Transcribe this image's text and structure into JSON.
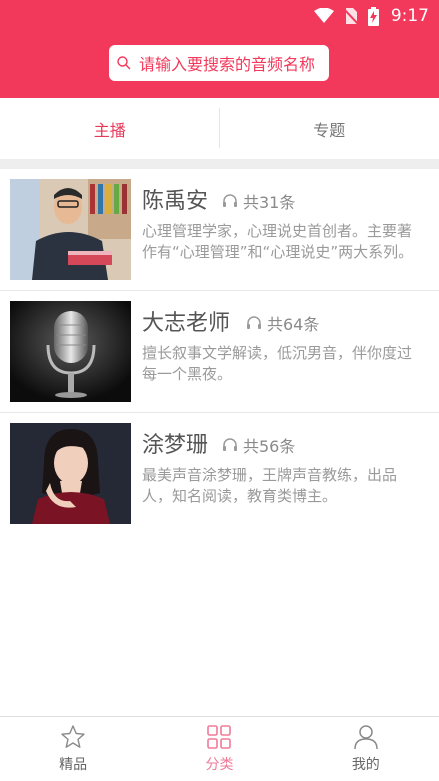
{
  "status": {
    "time": "9:17"
  },
  "search": {
    "placeholder": "请输入要搜索的音频名称"
  },
  "tabs": [
    {
      "label": "主播",
      "active": true
    },
    {
      "label": "专题",
      "active": false
    }
  ],
  "anchors": [
    {
      "name": "陈禹安",
      "count": "共31条",
      "desc": "心理管理学家，心理说史首创者。主要著作有“心理管理”和“心理说史”两大系列。",
      "photo": "photo-man-holding-book"
    },
    {
      "name": "大志老师",
      "count": "共64条",
      "desc": "擅长叙事文学解读，低沉男音，伴你度过每一个黑夜。",
      "photo": "photo-microphone"
    },
    {
      "name": "涂梦珊",
      "count": "共56条",
      "desc": "最美声音涂梦珊，王牌声音教练，出品人，知名阅读，教育类博主。",
      "photo": "photo-woman-portrait"
    }
  ],
  "bottom_nav": [
    {
      "label": "精品",
      "icon": "star-icon",
      "active": false
    },
    {
      "label": "分类",
      "icon": "grid-icon",
      "active": true
    },
    {
      "label": "我的",
      "icon": "person-icon",
      "active": false
    }
  ],
  "colors": {
    "brand": "#f2395b",
    "active_tab": "#e8385a",
    "nav_active": "#ef7b98"
  }
}
